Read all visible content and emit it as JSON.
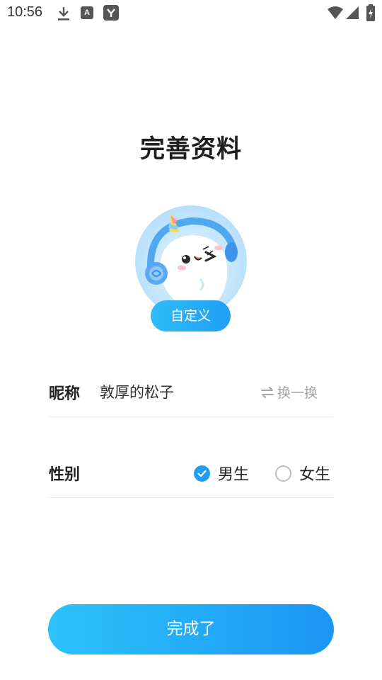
{
  "status_bar": {
    "time": "10:56",
    "icons": [
      "download-icon",
      "a-notification-icon",
      "app-notification-icon",
      "wifi-icon",
      "signal-icon",
      "battery-charging-icon"
    ]
  },
  "page": {
    "title": "完善资料"
  },
  "avatar": {
    "description_icon": "cartoon-avatar",
    "customize_label": "自定义"
  },
  "form": {
    "nickname": {
      "label": "昵称",
      "value": "敦厚的松子",
      "shuffle_label": "换一换",
      "shuffle_icon": "swap-icon"
    },
    "gender": {
      "label": "性别",
      "options": [
        {
          "label": "男生",
          "selected": true
        },
        {
          "label": "女生",
          "selected": false
        }
      ]
    }
  },
  "submit": {
    "label": "完成了"
  },
  "colors": {
    "accent": "#1e9ff3",
    "button_gradient_start": "#2cc2fb",
    "button_gradient_end": "#1b96f4",
    "muted_text": "#a5a5a5",
    "divider": "#e9e9e9"
  }
}
